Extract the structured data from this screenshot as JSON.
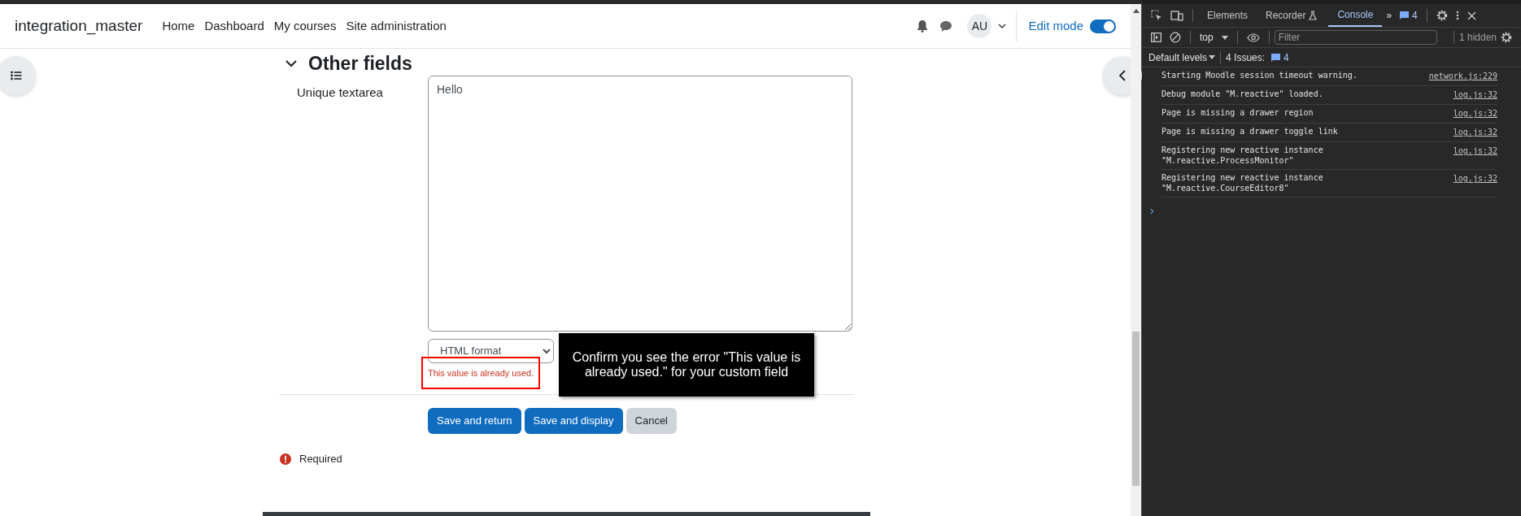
{
  "navbar": {
    "brand": "integration_master",
    "links": [
      {
        "label": "Home"
      },
      {
        "label": "Dashboard"
      },
      {
        "label": "My courses"
      },
      {
        "label": "Site administration"
      }
    ],
    "avatar": "AU",
    "edit_mode": {
      "label": "Edit mode",
      "on": true
    }
  },
  "form": {
    "section": {
      "title": "Other fields",
      "expanded": true
    },
    "field": {
      "label": "Unique textarea",
      "value": "Hello",
      "format": "HTML format",
      "error": "This value is already used."
    },
    "buttons": [
      {
        "label": "Save and return",
        "kind": "primary"
      },
      {
        "label": "Save and display",
        "kind": "primary"
      },
      {
        "label": "Cancel",
        "kind": "secondary"
      }
    ],
    "required_note": "Required"
  },
  "tooltip": "Confirm you see the error \"This value is already used.\" for your custom field",
  "devtools": {
    "tabs": [
      {
        "label": "Elements",
        "selected": false
      },
      {
        "label": "Recorder",
        "selected": false
      },
      {
        "label": "Console",
        "selected": true
      }
    ],
    "more_tabs": "»",
    "tab_issues": "4",
    "context": "top",
    "filter_placeholder": "Filter",
    "hidden": "1 hidden",
    "levels": "Default levels",
    "issues_label": "4 Issues:",
    "issues_badge": "4",
    "messages": [
      {
        "text": "Starting Moodle session timeout warning.",
        "source": "network.js:229"
      },
      {
        "text": "Debug module \"M.reactive\" loaded.",
        "source": "log.js:32"
      },
      {
        "text": "Page is missing a drawer region",
        "source": "log.js:32"
      },
      {
        "text": "Page is missing a drawer toggle link",
        "source": "log.js:32"
      },
      {
        "text": "Registering new reactive instance\n\"M.reactive.ProcessMonitor\"",
        "source": "log.js:32"
      },
      {
        "text": "Registering new reactive instance\n\"M.reactive.CourseEditor8\"",
        "source": "log.js:32"
      }
    ],
    "prompt": "›"
  }
}
